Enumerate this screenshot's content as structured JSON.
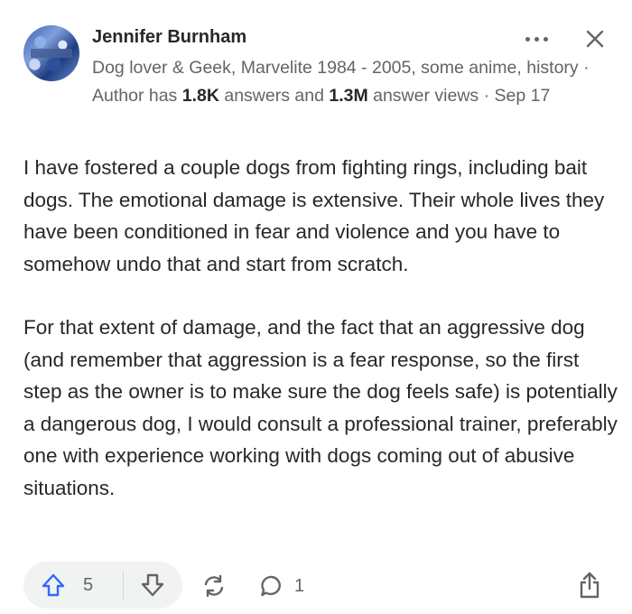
{
  "author": {
    "name": "Jennifer Burnham",
    "avatar_icon": "avatar-photo",
    "credential_prefix": "Dog lover & Geek, Marvelite 1984 - 2005, some anime, history · Author has ",
    "answers_count": "1.8K",
    "answers_label": " answers and ",
    "views_count": "1.3M",
    "views_label": " answer views · Sep 17"
  },
  "header_icons": {
    "more": "more-horizontal-icon",
    "close": "close-icon"
  },
  "answer": {
    "paragraph_1": "I have fostered a couple dogs from fighting rings, including bait dogs. The emotional damage is extensive. Their whole lives they have been conditioned in fear and violence and you have to somehow undo that and start from scratch.",
    "paragraph_2": "For that extent of damage, and the fact that an aggressive dog (and remember that aggression is a fear response, so the first step as the owner is to make sure the dog feels safe) is potentially a dangerous dog, I would consult a professional trainer, preferably one with experience working with dogs coming out of abusive situations."
  },
  "actions": {
    "upvote_count": "5",
    "comment_count": "1",
    "icons": [
      "upvote-arrow-icon",
      "downvote-arrow-icon",
      "reshare-icon",
      "comment-icon",
      "share-icon"
    ]
  },
  "colors": {
    "upvote_blue": "#2e69ff",
    "text": "#282829",
    "muted": "#636466",
    "pill_bg": "#f1f2f2"
  }
}
